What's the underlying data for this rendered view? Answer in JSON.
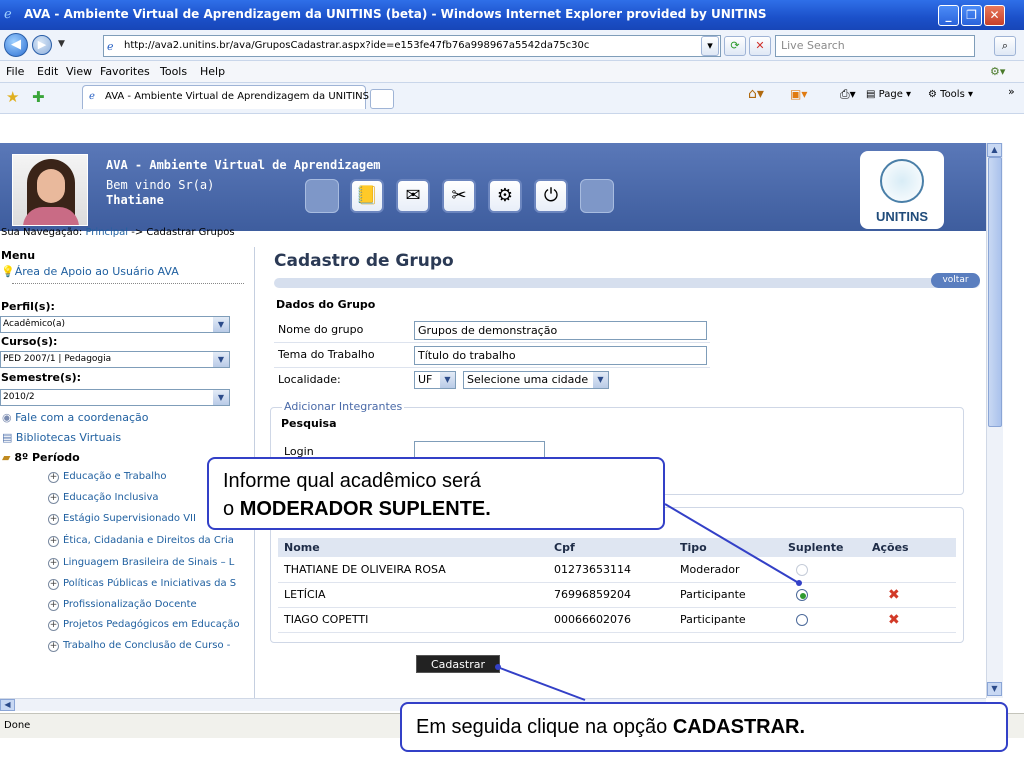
{
  "window": {
    "title": "AVA - Ambiente Virtual de Aprendizagem da UNITINS (beta) - Windows Internet Explorer provided by UNITINS",
    "minimize": "_",
    "maximize": "❐",
    "close": "✕"
  },
  "browser": {
    "url": "http://ava2.unitins.br/ava/GruposCadastrar.aspx?ide=e153fe47fb76a998967a5542da75c30c",
    "search_placeholder": "Live Search",
    "menu": [
      "File",
      "Edit",
      "View",
      "Favorites",
      "Tools",
      "Help"
    ],
    "tab_title": "AVA - Ambiente Virtual de Aprendizagem da UNITINS ...",
    "commands": {
      "page": "Page",
      "tools": "Tools"
    },
    "status": "Done"
  },
  "banner": {
    "title": "AVA - Ambiente Virtual de Aprendizagem",
    "welcome": "Bem vindo Sr(a)",
    "user": "Thatiane",
    "logo": "UNITINS"
  },
  "breadcrumb": {
    "prefix": "Sua Navegação:",
    "link": "Principal",
    "rest": "-> Cadastrar Grupos"
  },
  "sidebar": {
    "menu_label": "Menu",
    "help_link": "Área de Apoio ao Usuário AVA",
    "perfil_label": "Perfil(s):",
    "perfil_value": "Acadêmico(a)",
    "curso_label": "Curso(s):",
    "curso_value": "PED 2007/1 | Pedagogia",
    "semestre_label": "Semestre(s):",
    "semestre_value": "2010/2",
    "fale": "Fale com a coordenação",
    "bibliotecas": "Bibliotecas Virtuais",
    "periodo": "8º Período",
    "items": [
      "Educação e Trabalho",
      "Educação Inclusiva",
      "Estágio Supervisionado VII",
      "Ética, Cidadania e Direitos da Cria",
      "Linguagem Brasileira de Sinais – L",
      "Políticas Públicas e Iniciativas da S",
      "Profissionalização Docente",
      "Projetos Pedagógicos em Educação",
      "Trabalho de Conclusão de Curso -"
    ]
  },
  "main": {
    "heading": "Cadastro de Grupo",
    "back": "voltar",
    "section": "Dados do Grupo",
    "nome_label": "Nome do grupo",
    "nome_value": "Grupos de demonstração",
    "tema_label": "Tema do Trabalho",
    "tema_value": "Título do trabalho",
    "local_label": "Localidade:",
    "uf_value": "UF",
    "cidade_value": "Selecione uma cidade",
    "fieldset_legend": "Adicionar Integrantes",
    "pesquisa": "Pesquisa",
    "login_label": "Login",
    "table": {
      "headers": [
        "Nome",
        "Cpf",
        "Tipo",
        "Suplente",
        "Ações"
      ],
      "rows": [
        {
          "nome": "THATIANE DE OLIVEIRA ROSA",
          "cpf": "01273653114",
          "tipo": "Moderador"
        },
        {
          "nome": "LETÍCIA",
          "cpf": "76996859204",
          "tipo": "Participante"
        },
        {
          "nome": "TIAGO COPETTI",
          "cpf": "00066602076",
          "tipo": "Participante"
        }
      ]
    },
    "submit": "Cadastrar"
  },
  "callouts": {
    "top_line1": "Informe qual acadêmico será",
    "top_line2_prefix": "o",
    "top_line2_bold": "MODERADOR SUPLENTE.",
    "bottom_prefix": "Em seguida clique na opção",
    "bottom_bold": "CADASTRAR."
  },
  "colors": {
    "titlebar": "#1b50c9",
    "banner": "#4a6aad",
    "callout_border": "#3340c7",
    "delete": "#d23a28"
  }
}
